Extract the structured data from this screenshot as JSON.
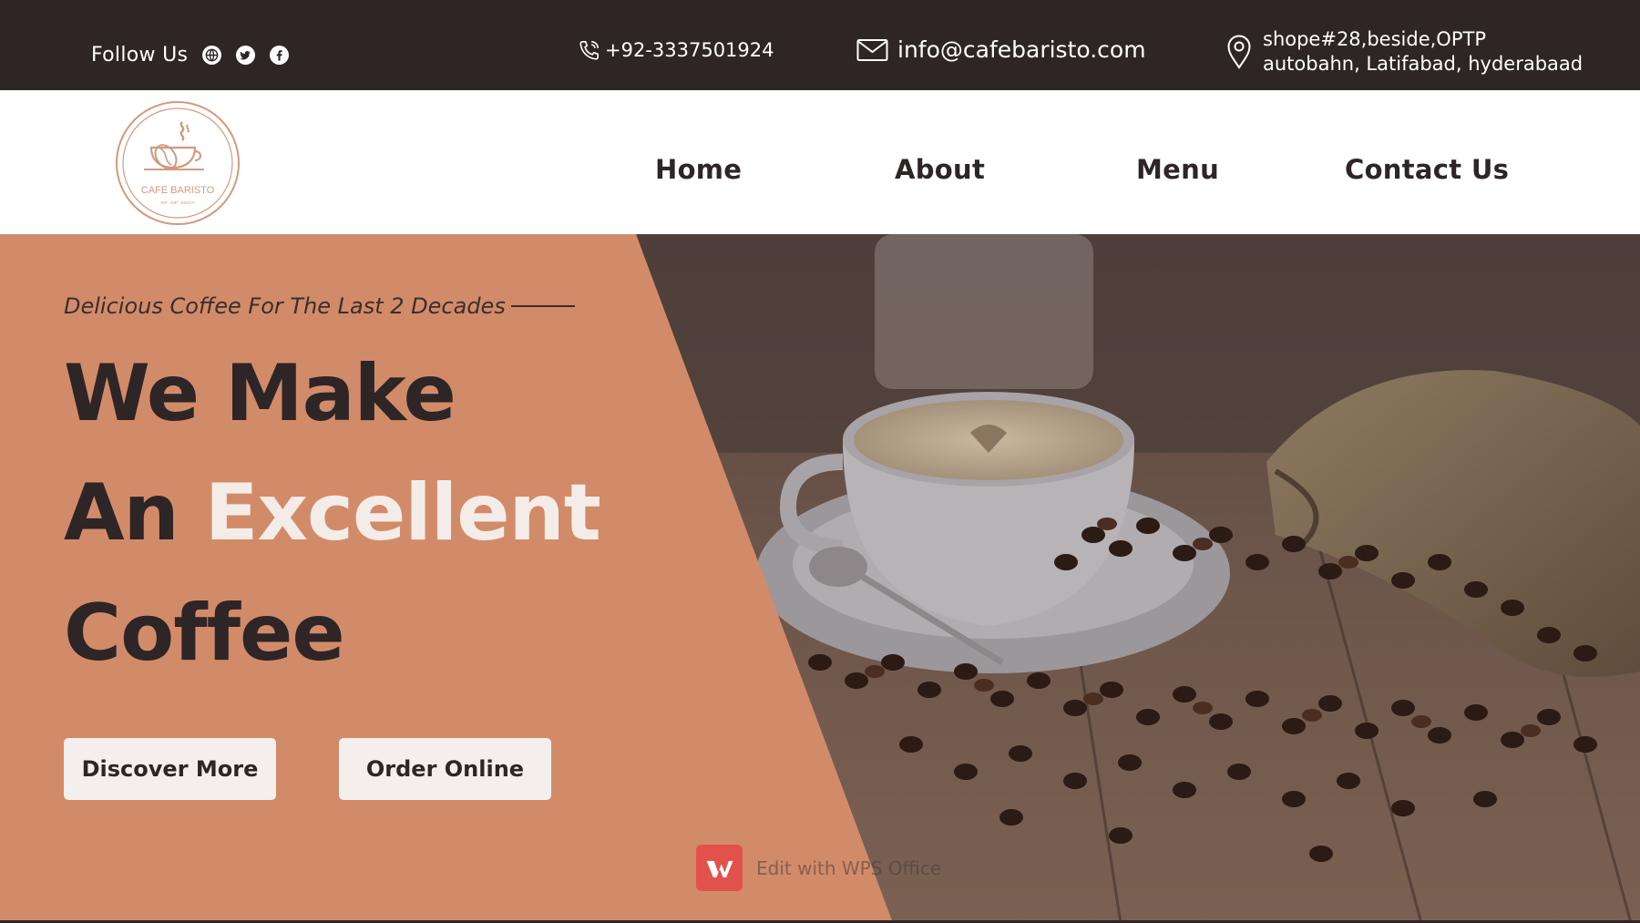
{
  "colors": {
    "dark": "#2e2526",
    "accent_orange": "#d28b69",
    "button_bg": "#f4efed",
    "accent_text": "#f4ece8",
    "logo_stroke": "#d09a80"
  },
  "topbar": {
    "follow_label": "Follow Us",
    "social_icons": [
      "globe-icon",
      "twitter-icon",
      "facebook-icon"
    ],
    "phone": "+92-3337501924",
    "email": "info@cafebaristo.com",
    "address_line1": "shope#28,beside,OPTP",
    "address_line2": "autobahn, Latifabad, hyderabaad"
  },
  "logo": {
    "name": "CAFE BARISTO",
    "tagline": "SIP · DIP · ENJOY"
  },
  "nav": {
    "items": [
      {
        "label": "Home"
      },
      {
        "label": "About"
      },
      {
        "label": "Menu"
      },
      {
        "label": "Contact Us"
      }
    ]
  },
  "hero": {
    "tagline": "Delicious Coffee For The Last 2 Decades",
    "headline_line1": "We Make",
    "headline_line2_prefix": "An",
    "headline_line2_accent": "Excellent",
    "headline_line3": "Coffee",
    "buttons": {
      "discover": "Discover More",
      "order": "Order Online"
    }
  },
  "watermark": {
    "text": "Edit with WPS Office"
  }
}
